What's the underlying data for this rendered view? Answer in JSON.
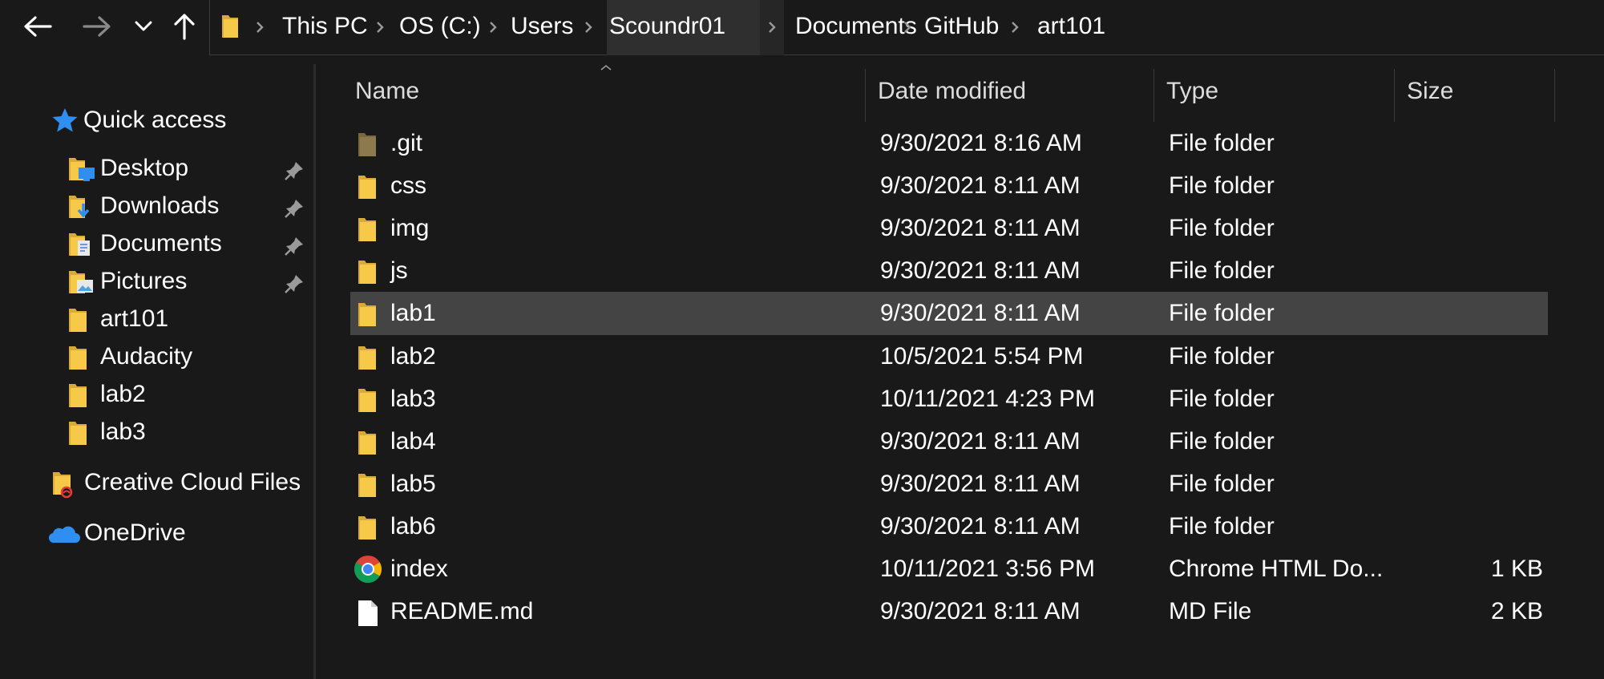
{
  "nav": {
    "back_icon": "back-arrow-icon",
    "forward_icon": "forward-arrow-icon",
    "recent_icon": "chevron-down-icon",
    "up_icon": "up-arrow-icon"
  },
  "breadcrumb": [
    "This PC",
    "OS (C:)",
    "Users",
    "Scoundr01",
    "Documents",
    "GitHub",
    "art101"
  ],
  "sidebar": {
    "quick_access": "Quick access",
    "items": [
      {
        "label": "Desktop",
        "icon": "desktop-folder-icon",
        "pinned": true
      },
      {
        "label": "Downloads",
        "icon": "downloads-folder-icon",
        "pinned": true
      },
      {
        "label": "Documents",
        "icon": "documents-folder-icon",
        "pinned": true
      },
      {
        "label": "Pictures",
        "icon": "pictures-folder-icon",
        "pinned": true
      },
      {
        "label": "art101",
        "icon": "folder-icon",
        "pinned": false
      },
      {
        "label": "Audacity",
        "icon": "folder-icon",
        "pinned": false
      },
      {
        "label": "lab2",
        "icon": "folder-icon",
        "pinned": false
      },
      {
        "label": "lab3",
        "icon": "folder-icon",
        "pinned": false
      }
    ],
    "creative_cloud": "Creative Cloud Files",
    "onedrive": "OneDrive"
  },
  "columns": {
    "name": "Name",
    "date": "Date modified",
    "type": "Type",
    "size": "Size"
  },
  "files": [
    {
      "name": ".git",
      "date": "9/30/2021 8:16 AM",
      "type": "File folder",
      "size": "",
      "icon": "hidden-folder-icon"
    },
    {
      "name": "css",
      "date": "9/30/2021 8:11 AM",
      "type": "File folder",
      "size": "",
      "icon": "folder-icon"
    },
    {
      "name": "img",
      "date": "9/30/2021 8:11 AM",
      "type": "File folder",
      "size": "",
      "icon": "folder-icon"
    },
    {
      "name": "js",
      "date": "9/30/2021 8:11 AM",
      "type": "File folder",
      "size": "",
      "icon": "folder-icon"
    },
    {
      "name": "lab1",
      "date": "9/30/2021 8:11 AM",
      "type": "File folder",
      "size": "",
      "icon": "folder-icon",
      "selected": true
    },
    {
      "name": "lab2",
      "date": "10/5/2021 5:54 PM",
      "type": "File folder",
      "size": "",
      "icon": "folder-icon"
    },
    {
      "name": "lab3",
      "date": "10/11/2021 4:23 PM",
      "type": "File folder",
      "size": "",
      "icon": "folder-icon"
    },
    {
      "name": "lab4",
      "date": "9/30/2021 8:11 AM",
      "type": "File folder",
      "size": "",
      "icon": "folder-icon"
    },
    {
      "name": "lab5",
      "date": "9/30/2021 8:11 AM",
      "type": "File folder",
      "size": "",
      "icon": "folder-icon"
    },
    {
      "name": "lab6",
      "date": "9/30/2021 8:11 AM",
      "type": "File folder",
      "size": "",
      "icon": "folder-icon"
    },
    {
      "name": "index",
      "date": "10/11/2021 3:56 PM",
      "type": "Chrome HTML Do...",
      "size": "1 KB",
      "icon": "chrome-icon"
    },
    {
      "name": "README.md",
      "date": "9/30/2021 8:11 AM",
      "type": "MD File",
      "size": "2 KB",
      "icon": "file-icon"
    }
  ],
  "colors": {
    "background": "#191919",
    "selected_row": "#444444",
    "folder_yellow": "#f7c948",
    "accent_blue": "#2f8ff0"
  }
}
